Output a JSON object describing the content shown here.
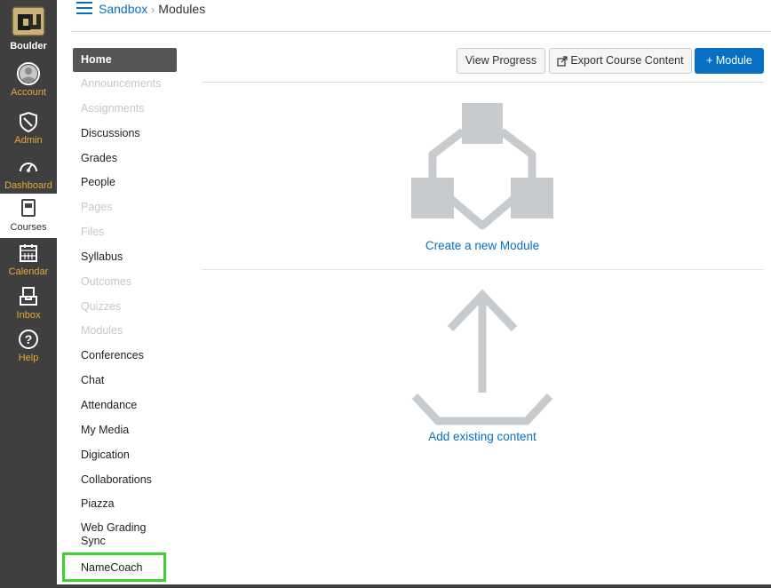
{
  "global_nav": {
    "logo_label": "Boulder",
    "items": [
      {
        "label": "Account",
        "icon": "account-icon"
      },
      {
        "label": "Admin",
        "icon": "shield-icon"
      },
      {
        "label": "Dashboard",
        "icon": "speedometer-icon"
      },
      {
        "label": "Courses",
        "icon": "book-icon",
        "active": true
      },
      {
        "label": "Calendar",
        "icon": "calendar-icon"
      },
      {
        "label": "Inbox",
        "icon": "inbox-icon"
      },
      {
        "label": "Help",
        "icon": "help-icon"
      }
    ],
    "accent_color": "#e8a83a",
    "background_color": "#3f3f3f"
  },
  "breadcrumb": {
    "course": "Sandbox",
    "separator": "›",
    "current": "Modules"
  },
  "course_nav": {
    "items": [
      {
        "label": "Home",
        "state": "active"
      },
      {
        "label": "Announcements",
        "state": "disabled"
      },
      {
        "label": "Assignments",
        "state": "disabled"
      },
      {
        "label": "Discussions",
        "state": "enabled"
      },
      {
        "label": "Grades",
        "state": "enabled"
      },
      {
        "label": "People",
        "state": "enabled"
      },
      {
        "label": "Pages",
        "state": "disabled"
      },
      {
        "label": "Files",
        "state": "disabled"
      },
      {
        "label": "Syllabus",
        "state": "enabled"
      },
      {
        "label": "Outcomes",
        "state": "disabled"
      },
      {
        "label": "Quizzes",
        "state": "disabled"
      },
      {
        "label": "Modules",
        "state": "disabled"
      },
      {
        "label": "Conferences",
        "state": "enabled"
      },
      {
        "label": "Chat",
        "state": "enabled"
      },
      {
        "label": "Attendance",
        "state": "enabled"
      },
      {
        "label": "My Media",
        "state": "enabled"
      },
      {
        "label": "Digication",
        "state": "enabled"
      },
      {
        "label": "Collaborations",
        "state": "enabled"
      },
      {
        "label": "Piazza",
        "state": "enabled"
      },
      {
        "label": "Web Grading Sync",
        "state": "enabled"
      },
      {
        "label": "NameCoach",
        "state": "highlighted"
      }
    ],
    "highlight_color": "#3bd22e"
  },
  "toolbar": {
    "view_progress": "View Progress",
    "export_content": "Export Course Content",
    "add_module": "+ Module",
    "primary_color": "#0770c5"
  },
  "empty_state": {
    "create_module": "Create a new Module",
    "add_existing": "Add existing content"
  }
}
